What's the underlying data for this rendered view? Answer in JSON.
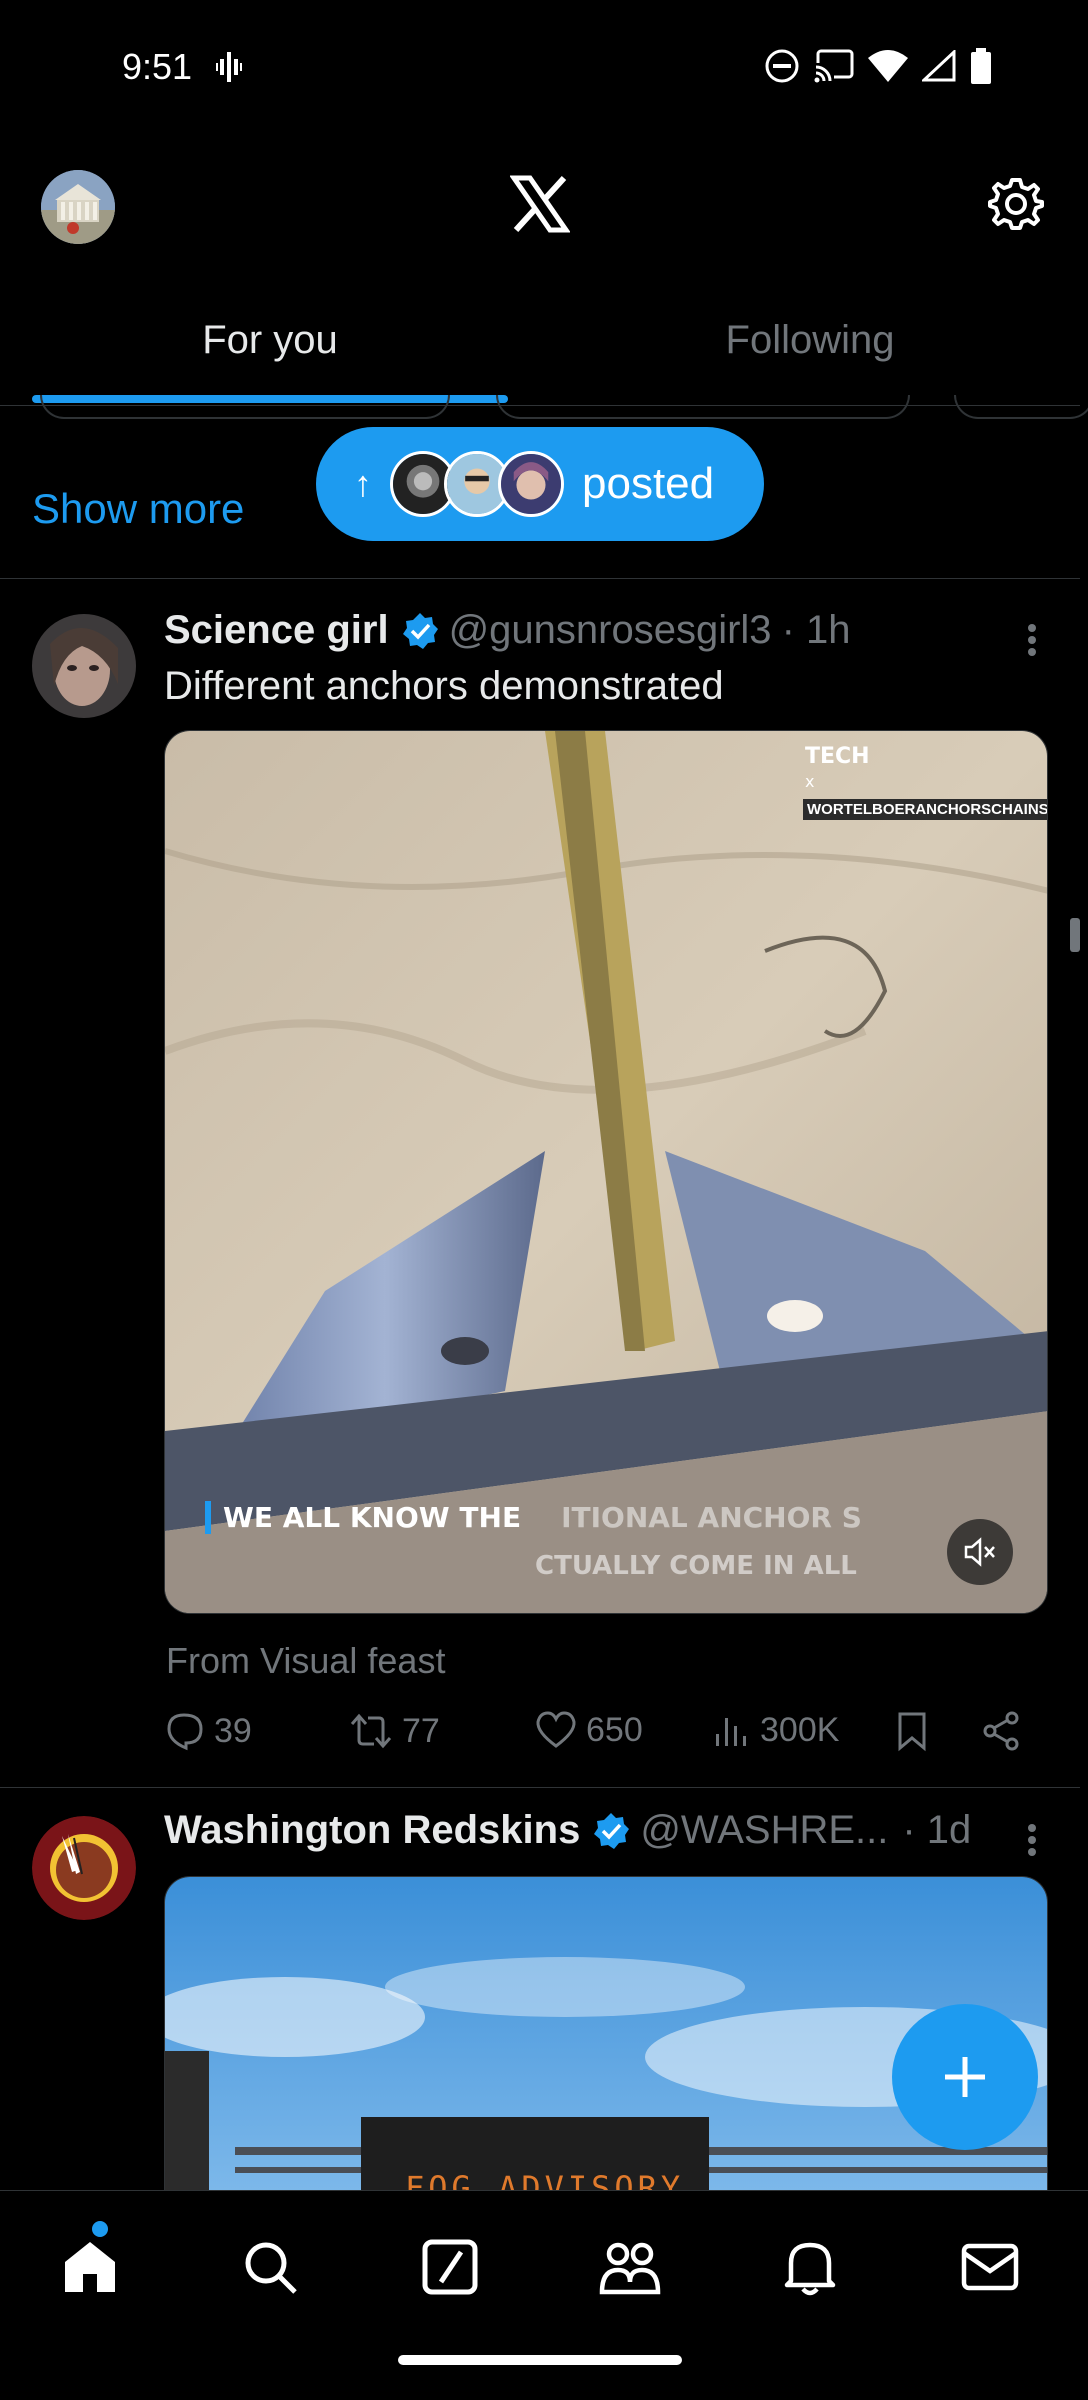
{
  "status_bar": {
    "time": "9:51",
    "icons": [
      "vibrate-icon",
      "do-not-disturb-icon",
      "cast-icon",
      "wifi-icon",
      "signal-icon",
      "battery-icon"
    ]
  },
  "header": {
    "logo": "X",
    "profile_icon": "avatar",
    "settings_icon": "gear-icon"
  },
  "tabs": [
    {
      "label": "For you",
      "active": true
    },
    {
      "label": "Following",
      "active": false
    }
  ],
  "banner": {
    "show_more_label": "Show more",
    "posted_label": "posted"
  },
  "tweets": [
    {
      "name": "Science girl",
      "verified": true,
      "handle": "@gunsnrosesgirl3",
      "time": "· 1h",
      "text": "Different anchors demonstrated",
      "media": {
        "watermark": "WORTELBOERANCHORSCHAINS",
        "caption_line1": "WE ALL KNOW THE",
        "caption_line1b": "ITIONAL ANCHOR S",
        "caption_line2": "CTUALLY COME IN ALL",
        "muted": true
      },
      "source": "From Visual feast",
      "stats": {
        "replies": "39",
        "reposts": "77",
        "likes": "650",
        "views": "300K"
      }
    },
    {
      "name": "Washington Redskins",
      "verified": true,
      "handle": "@WASHRE...",
      "time": "· 1d",
      "media": {
        "sign_text": "FOG ADVISORY"
      }
    }
  ],
  "colors": {
    "accent": "#1d9bf0",
    "background": "#000000",
    "text_primary": "#e7e9ea",
    "text_secondary": "#71767b",
    "divider": "#2f3336"
  },
  "bottom_nav": [
    "home-icon",
    "search-icon",
    "grok-icon",
    "communities-icon",
    "notifications-icon",
    "messages-icon"
  ]
}
